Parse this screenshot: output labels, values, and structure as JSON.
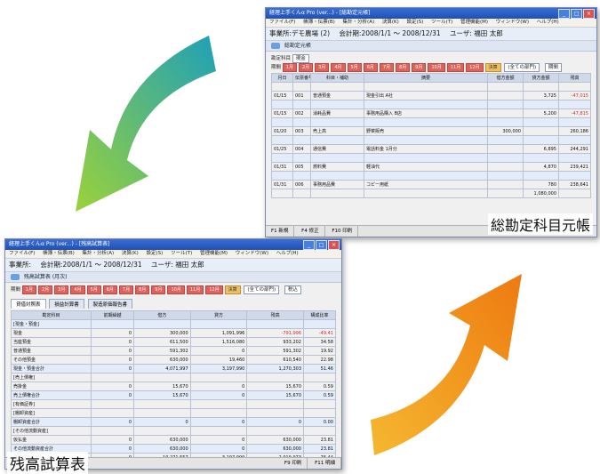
{
  "top_window": {
    "title": "経理上手くんα Pro (ver...) - [総勘定元帳]",
    "menu": [
      "ファイル(F)",
      "帳簿・伝票(B)",
      "集計・分析(A)",
      "決算(K)",
      "設定(S)",
      "ツール(T)",
      "管理機能(M)",
      "ウィンドウ(W)",
      "ヘルプ(H)"
    ],
    "office_label": "事業所:デモ農場 (2)",
    "period_label": "会計期:2008/1/1 ～ 2008/12/31",
    "user_label": "ユーザ: 福田 太郎",
    "doc_title": "総勘定元帳",
    "account_label": "勘定科目",
    "account_value": "現金",
    "period_caption": "期間",
    "months": [
      "1月",
      "2月",
      "3月",
      "4月",
      "5月",
      "6月",
      "7月",
      "8月",
      "9月",
      "10月",
      "11月",
      "12月",
      "決算"
    ],
    "dept_select": "(全ての部門)",
    "scope_select": "期間",
    "columns": [
      "月日",
      "伝票番号",
      "科目・補助",
      "摘要",
      "借方金額",
      "貸方金額",
      "残高"
    ],
    "rows": [
      {
        "date": "01/15",
        "no": "001",
        "account": "普通預金",
        "memo": "現金引出 A社",
        "debit": "",
        "credit": "3,725",
        "balance": "-47,015"
      },
      {
        "date": "01/15",
        "no": "002",
        "account": "消耗品費",
        "memo": "事務用品購入 B店",
        "debit": "",
        "credit": "5,200",
        "balance": "-47,815"
      },
      {
        "date": "01/20",
        "no": "003",
        "account": "売上高",
        "memo": "野菜販売",
        "debit": "300,000",
        "credit": "",
        "balance": "260,186"
      },
      {
        "date": "01/25",
        "no": "004",
        "account": "通信費",
        "memo": "電話料金 1月分",
        "debit": "",
        "credit": "6,895",
        "balance": "244,291"
      },
      {
        "date": "01/31",
        "no": "005",
        "account": "燃料費",
        "memo": "軽油代",
        "debit": "",
        "credit": "4,870",
        "balance": "239,421"
      },
      {
        "date": "01/31",
        "no": "006",
        "account": "事務用品費",
        "memo": "コピー用紙",
        "debit": "",
        "credit": "780",
        "balance": "238,641"
      }
    ],
    "total_label": "1,080,000",
    "status": [
      "F1 新規",
      "F4 修正",
      "F10 印刷"
    ]
  },
  "bottom_window": {
    "title": "経理上手くんα Pro (ver...) - [残高試算表]",
    "menu": [
      "ファイル(F)",
      "帳簿・伝票(B)",
      "集計・分析(A)",
      "決算(K)",
      "設定(S)",
      "ツール(T)",
      "管理機能(M)",
      "ウィンドウ(W)",
      "ヘルプ(H)"
    ],
    "office_label": "事業所:",
    "period_label": "会計期:2008/1/1 ～ 2008/12/31",
    "user_label": "ユーザ: 福田 太郎",
    "doc_title": "残高試算表 (月次)",
    "period_caption": "期間",
    "months": [
      "1月",
      "2月",
      "3月",
      "4月",
      "5月",
      "6月",
      "7月",
      "8月",
      "9月",
      "10月",
      "11月",
      "12月",
      "決算"
    ],
    "dept_select": "(全ての部門)",
    "scope_select": "税込",
    "tabs": [
      "貸借対照表",
      "損益計算書",
      "製造原価報告書"
    ],
    "columns": [
      "勘定科目",
      "前期繰越",
      "借方",
      "貸方",
      "残高",
      "構成比率"
    ],
    "rows": [
      {
        "name": "[現金・預金]",
        "prev": "",
        "debit": "",
        "credit": "",
        "bal": "",
        "ratio": "",
        "hl": true
      },
      {
        "name": "現金",
        "prev": "0",
        "debit": "300,000",
        "credit": "1,091,996",
        "bal": "-791,996",
        "ratio": "-49.41",
        "red": true
      },
      {
        "name": "当座預金",
        "prev": "0",
        "debit": "611,500",
        "credit": "1,516,080",
        "bal": "933,202",
        "ratio": "34.58"
      },
      {
        "name": "普通預金",
        "prev": "0",
        "debit": "591,302",
        "credit": "0",
        "bal": "591,302",
        "ratio": "19.92"
      },
      {
        "name": "その他預金",
        "prev": "0",
        "debit": "630,000",
        "credit": "19,460",
        "bal": "610,540",
        "ratio": "22.98"
      },
      {
        "name": "現金・預金合計",
        "prev": "0",
        "debit": "4,071,997",
        "credit": "3,197,990",
        "bal": "1,270,303",
        "ratio": "51.46",
        "hl": true
      },
      {
        "name": "[売上債権]",
        "prev": "",
        "debit": "",
        "credit": "",
        "bal": "",
        "ratio": ""
      },
      {
        "name": "売掛金",
        "prev": "0",
        "debit": "15,670",
        "credit": "0",
        "bal": "15,670",
        "ratio": "0.59"
      },
      {
        "name": "売上債権合計",
        "prev": "0",
        "debit": "15,670",
        "credit": "0",
        "bal": "15,670",
        "ratio": "0.59",
        "hl": true
      },
      {
        "name": "[有価証券]",
        "prev": "",
        "debit": "",
        "credit": "",
        "bal": "",
        "ratio": ""
      },
      {
        "name": "[棚卸資産]",
        "prev": "",
        "debit": "",
        "credit": "",
        "bal": "",
        "ratio": ""
      },
      {
        "name": "棚卸資産合計",
        "prev": "0",
        "debit": "0",
        "credit": "0",
        "bal": "0",
        "ratio": "0.00",
        "hl": true
      },
      {
        "name": "[その他流動資産]",
        "prev": "",
        "debit": "",
        "credit": "",
        "bal": "",
        "ratio": ""
      },
      {
        "name": "仮払金",
        "prev": "0",
        "debit": "630,000",
        "credit": "0",
        "bal": "630,000",
        "ratio": "23.81"
      },
      {
        "name": "その他流動資産合計",
        "prev": "0",
        "debit": "630,000",
        "credit": "0",
        "bal": "630,000",
        "ratio": "23.81",
        "hl": true
      },
      {
        "name": "流動資産合計",
        "prev": "0",
        "debit": "10,271,557",
        "credit": "3,197,990",
        "bal": "2,019,973",
        "ratio": "76.44"
      }
    ],
    "status": [
      "F9 印刷",
      "F11 明細"
    ]
  },
  "captions": {
    "ledger": "総勘定科目元帳",
    "trial_balance": "残高試算表"
  },
  "colors": {
    "green_arrow": "#5cbf4a",
    "orange_arrow": "#f5a020"
  }
}
